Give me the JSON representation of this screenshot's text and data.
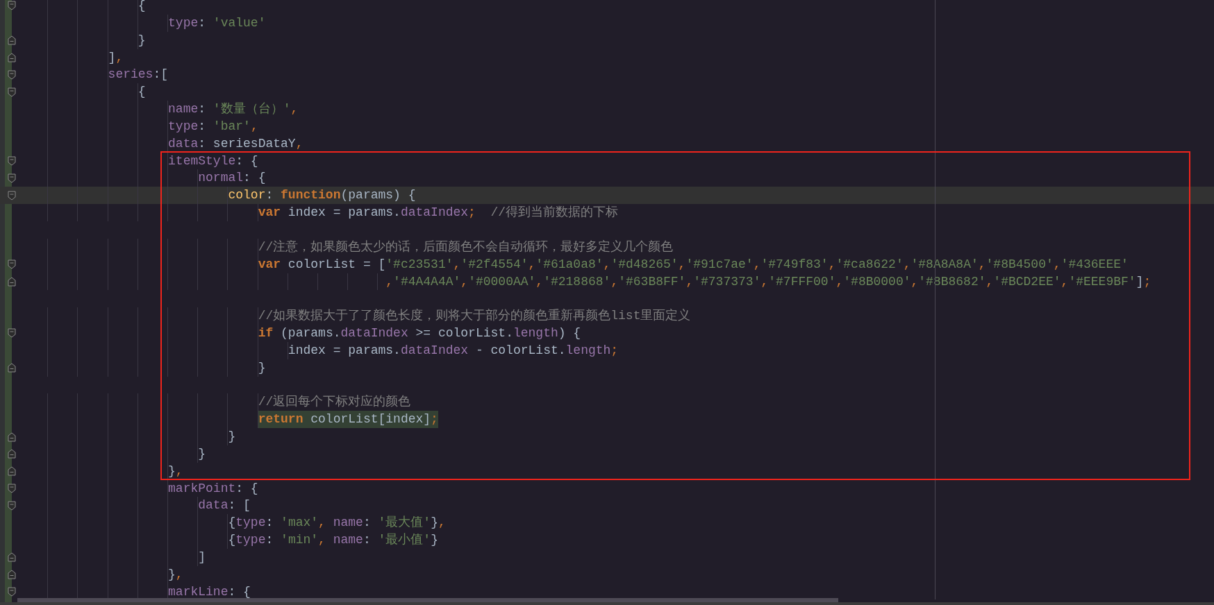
{
  "editor": {
    "lines": [
      {
        "current": false,
        "usage_highlight": false,
        "fold_start": true,
        "fold_end": false,
        "tokens": [
          {
            "t": "{",
            "kind": "plain"
          }
        ]
      },
      {
        "current": false,
        "usage_highlight": false,
        "fold_start": false,
        "fold_end": false,
        "tokens": [
          {
            "t": "type",
            "kind": "key"
          },
          {
            "t": ": ",
            "kind": "plain"
          },
          {
            "t": "'value'",
            "kind": "str"
          }
        ]
      },
      {
        "current": false,
        "usage_highlight": false,
        "fold_start": false,
        "fold_end": true,
        "tokens": [
          {
            "t": "}",
            "kind": "plain"
          }
        ]
      },
      {
        "current": false,
        "usage_highlight": false,
        "fold_start": false,
        "fold_end": true,
        "tokens": [
          {
            "t": "]",
            "kind": "plain"
          },
          {
            "t": ",",
            "kind": "punct"
          }
        ]
      },
      {
        "current": false,
        "usage_highlight": false,
        "fold_start": true,
        "fold_end": false,
        "tokens": [
          {
            "t": "series",
            "kind": "key"
          },
          {
            "t": ":[",
            "kind": "plain"
          }
        ]
      },
      {
        "current": false,
        "usage_highlight": false,
        "fold_start": true,
        "fold_end": false,
        "tokens": [
          {
            "t": "{",
            "kind": "plain"
          }
        ]
      },
      {
        "current": false,
        "usage_highlight": false,
        "fold_start": false,
        "fold_end": false,
        "tokens": [
          {
            "t": "name",
            "kind": "key"
          },
          {
            "t": ": ",
            "kind": "plain"
          },
          {
            "t": "'数量（台）'",
            "kind": "str"
          },
          {
            "t": ",",
            "kind": "punct"
          }
        ]
      },
      {
        "current": false,
        "usage_highlight": false,
        "fold_start": false,
        "fold_end": false,
        "tokens": [
          {
            "t": "type",
            "kind": "key"
          },
          {
            "t": ": ",
            "kind": "plain"
          },
          {
            "t": "'bar'",
            "kind": "str"
          },
          {
            "t": ",",
            "kind": "punct"
          }
        ]
      },
      {
        "current": false,
        "usage_highlight": false,
        "fold_start": false,
        "fold_end": false,
        "tokens": [
          {
            "t": "data",
            "kind": "key"
          },
          {
            "t": ": seriesDataY",
            "kind": "plain"
          },
          {
            "t": ",",
            "kind": "punct"
          }
        ]
      },
      {
        "current": false,
        "usage_highlight": false,
        "fold_start": true,
        "fold_end": false,
        "tokens": [
          {
            "t": "itemStyle",
            "kind": "key"
          },
          {
            "t": ": {",
            "kind": "plain"
          }
        ]
      },
      {
        "current": false,
        "usage_highlight": false,
        "fold_start": true,
        "fold_end": false,
        "tokens": [
          {
            "t": "normal",
            "kind": "key"
          },
          {
            "t": ": {",
            "kind": "plain"
          }
        ]
      },
      {
        "current": true,
        "usage_highlight": false,
        "fold_start": true,
        "fold_end": false,
        "tokens": [
          {
            "t": "color",
            "kind": "fn"
          },
          {
            "t": ": ",
            "kind": "plain"
          },
          {
            "t": "function",
            "kind": "kw"
          },
          {
            "t": "(params) {",
            "kind": "plain"
          }
        ]
      },
      {
        "current": false,
        "usage_highlight": false,
        "fold_start": false,
        "fold_end": false,
        "tokens": [
          {
            "t": "var",
            "kind": "kw"
          },
          {
            "t": " index = params.",
            "kind": "plain"
          },
          {
            "t": "dataIndex",
            "kind": "key"
          },
          {
            "t": ";",
            "kind": "punct"
          },
          {
            "t": "  //得到当前数据的下标",
            "kind": "comment"
          }
        ]
      },
      {
        "current": false,
        "fold_start": false,
        "fold_end": false
      },
      {
        "current": false,
        "usage_highlight": false,
        "fold_start": false,
        "fold_end": false,
        "tokens": [
          {
            "t": "//注意，如果颜色太少的话，后面颜色不会自动循环，最好多定义几个颜色",
            "kind": "comment"
          }
        ]
      },
      {
        "current": false,
        "usage_highlight": false,
        "fold_start": true,
        "fold_end": false,
        "tokens": [
          {
            "t": "var",
            "kind": "kw"
          },
          {
            "t": " colorList = [",
            "kind": "plain"
          },
          {
            "t": "'#c23531'",
            "kind": "str"
          },
          {
            "t": ",",
            "kind": "punct"
          },
          {
            "t": "'#2f4554'",
            "kind": "str"
          },
          {
            "t": ",",
            "kind": "punct"
          },
          {
            "t": "'#61a0a8'",
            "kind": "str"
          },
          {
            "t": ",",
            "kind": "punct"
          },
          {
            "t": "'#d48265'",
            "kind": "str"
          },
          {
            "t": ",",
            "kind": "punct"
          },
          {
            "t": "'#91c7ae'",
            "kind": "str"
          },
          {
            "t": ",",
            "kind": "punct"
          },
          {
            "t": "'#749f83'",
            "kind": "str"
          },
          {
            "t": ",",
            "kind": "punct"
          },
          {
            "t": "'#ca8622'",
            "kind": "str"
          },
          {
            "t": ",",
            "kind": "punct"
          },
          {
            "t": "'#8A8A8A'",
            "kind": "str"
          },
          {
            "t": ",",
            "kind": "punct"
          },
          {
            "t": "'#8B4500'",
            "kind": "str"
          },
          {
            "t": ",",
            "kind": "punct"
          },
          {
            "t": "'#436EEE'",
            "kind": "str"
          }
        ]
      },
      {
        "current": false,
        "usage_highlight": false,
        "fold_start": false,
        "fold_end": true,
        "tokens": [
          {
            "t": ",",
            "kind": "punct"
          },
          {
            "t": "'#4A4A4A'",
            "kind": "str"
          },
          {
            "t": ",",
            "kind": "punct"
          },
          {
            "t": "'#0000AA'",
            "kind": "str"
          },
          {
            "t": ",",
            "kind": "punct"
          },
          {
            "t": "'#218868'",
            "kind": "str"
          },
          {
            "t": ",",
            "kind": "punct"
          },
          {
            "t": "'#63B8FF'",
            "kind": "str"
          },
          {
            "t": ",",
            "kind": "punct"
          },
          {
            "t": "'#737373'",
            "kind": "str"
          },
          {
            "t": ",",
            "kind": "punct"
          },
          {
            "t": "'#7FFF00'",
            "kind": "str"
          },
          {
            "t": ",",
            "kind": "punct"
          },
          {
            "t": "'#8B0000'",
            "kind": "str"
          },
          {
            "t": ",",
            "kind": "punct"
          },
          {
            "t": "'#8B8682'",
            "kind": "str"
          },
          {
            "t": ",",
            "kind": "punct"
          },
          {
            "t": "'#BCD2EE'",
            "kind": "str"
          },
          {
            "t": ",",
            "kind": "punct"
          },
          {
            "t": "'#EEE9BF'",
            "kind": "str"
          },
          {
            "t": "]",
            "kind": "plain"
          },
          {
            "t": ";",
            "kind": "punct"
          }
        ]
      },
      {
        "current": false,
        "fold_start": false,
        "fold_end": false
      },
      {
        "current": false,
        "usage_highlight": false,
        "fold_start": false,
        "fold_end": false,
        "tokens": [
          {
            "t": "//如果数据大于了了颜色长度，则将大于部分的颜色重新再颜色list里面定义",
            "kind": "comment"
          }
        ]
      },
      {
        "current": false,
        "usage_highlight": false,
        "fold_start": true,
        "fold_end": false,
        "tokens": [
          {
            "t": "if",
            "kind": "kw"
          },
          {
            "t": " (params.",
            "kind": "plain"
          },
          {
            "t": "dataIndex",
            "kind": "key"
          },
          {
            "t": " >= colorList.",
            "kind": "plain"
          },
          {
            "t": "length",
            "kind": "key"
          },
          {
            "t": ") {",
            "kind": "plain"
          }
        ]
      },
      {
        "current": false,
        "usage_highlight": false,
        "fold_start": false,
        "fold_end": false,
        "tokens": [
          {
            "t": "index = params.",
            "kind": "plain"
          },
          {
            "t": "dataIndex",
            "kind": "key"
          },
          {
            "t": " - colorList.",
            "kind": "plain"
          },
          {
            "t": "length",
            "kind": "key"
          },
          {
            "t": ";",
            "kind": "punct"
          }
        ]
      },
      {
        "current": false,
        "usage_highlight": false,
        "fold_start": false,
        "fold_end": true,
        "tokens": [
          {
            "t": "}",
            "kind": "plain"
          }
        ]
      },
      {
        "current": false,
        "fold_start": false,
        "fold_end": false
      },
      {
        "current": false,
        "usage_highlight": false,
        "fold_start": false,
        "fold_end": false,
        "tokens": [
          {
            "t": "//返回每个下标对应的颜色",
            "kind": "comment"
          }
        ]
      },
      {
        "current": false,
        "usage_highlight": true,
        "fold_start": false,
        "fold_end": false,
        "tokens": [
          {
            "t": "return",
            "kind": "kw"
          },
          {
            "t": " colorList[index]",
            "kind": "plain"
          },
          {
            "t": ";",
            "kind": "punct"
          }
        ]
      },
      {
        "current": false,
        "usage_highlight": false,
        "fold_start": false,
        "fold_end": true,
        "tokens": [
          {
            "t": "}",
            "kind": "plain"
          }
        ]
      },
      {
        "current": false,
        "usage_highlight": false,
        "fold_start": false,
        "fold_end": true,
        "tokens": [
          {
            "t": "}",
            "kind": "plain"
          }
        ]
      },
      {
        "current": false,
        "usage_highlight": false,
        "fold_start": false,
        "fold_end": true,
        "tokens": [
          {
            "t": "}",
            "kind": "plain"
          },
          {
            "t": ",",
            "kind": "punct"
          }
        ]
      },
      {
        "current": false,
        "usage_highlight": false,
        "fold_start": true,
        "fold_end": false,
        "tokens": [
          {
            "t": "markPoint",
            "kind": "key"
          },
          {
            "t": ": {",
            "kind": "plain"
          }
        ]
      },
      {
        "current": false,
        "usage_highlight": false,
        "fold_start": true,
        "fold_end": false,
        "tokens": [
          {
            "t": "data",
            "kind": "key"
          },
          {
            "t": ": [",
            "kind": "plain"
          }
        ]
      },
      {
        "current": false,
        "usage_highlight": false,
        "fold_start": false,
        "fold_end": false,
        "tokens": [
          {
            "t": "{",
            "kind": "plain"
          },
          {
            "t": "type",
            "kind": "key"
          },
          {
            "t": ": ",
            "kind": "plain"
          },
          {
            "t": "'max'",
            "kind": "str"
          },
          {
            "t": ", ",
            "kind": "punct"
          },
          {
            "t": "name",
            "kind": "key"
          },
          {
            "t": ": ",
            "kind": "plain"
          },
          {
            "t": "'最大值'",
            "kind": "str"
          },
          {
            "t": "}",
            "kind": "plain"
          },
          {
            "t": ",",
            "kind": "punct"
          }
        ]
      },
      {
        "current": false,
        "usage_highlight": false,
        "fold_start": false,
        "fold_end": false,
        "tokens": [
          {
            "t": "{",
            "kind": "plain"
          },
          {
            "t": "type",
            "kind": "key"
          },
          {
            "t": ": ",
            "kind": "plain"
          },
          {
            "t": "'min'",
            "kind": "str"
          },
          {
            "t": ", ",
            "kind": "punct"
          },
          {
            "t": "name",
            "kind": "key"
          },
          {
            "t": ": ",
            "kind": "plain"
          },
          {
            "t": "'最小值'",
            "kind": "str"
          },
          {
            "t": "}",
            "kind": "plain"
          }
        ]
      },
      {
        "current": false,
        "usage_highlight": false,
        "fold_start": false,
        "fold_end": true,
        "tokens": [
          {
            "t": "]",
            "kind": "plain"
          }
        ]
      },
      {
        "current": false,
        "usage_highlight": false,
        "fold_start": false,
        "fold_end": true,
        "tokens": [
          {
            "t": "}",
            "kind": "plain"
          },
          {
            "t": ",",
            "kind": "punct"
          }
        ]
      },
      {
        "current": false,
        "usage_highlight": false,
        "fold_start": true,
        "fold_end": false,
        "tokens": [
          {
            "t": "markLine",
            "kind": "key"
          },
          {
            "t": ": {",
            "kind": "plain"
          }
        ]
      }
    ]
  }
}
